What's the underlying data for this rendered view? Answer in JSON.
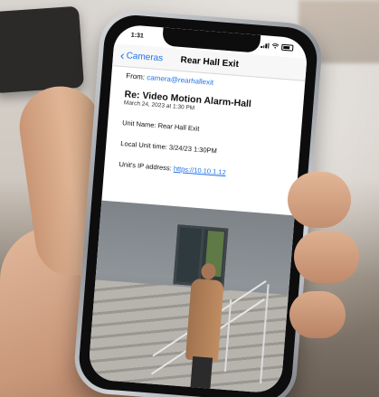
{
  "status_bar": {
    "time": "1:31"
  },
  "nav": {
    "back_label": "Cameras",
    "title": "Rear Hall Exit"
  },
  "email": {
    "from_label": "From:",
    "from_address": "camera@rearhallexit",
    "subject": "Re: Video Motion Alarm-Hall",
    "date": "March 24, 2023 at 1:30 PM",
    "unit_name": "Unit Name: Rear Hall Exit",
    "local_time": "Local Unit time: 3/24/23 1:30PM",
    "ip_label": "Unit's IP address:",
    "ip_link": "https://10.10.1.12"
  },
  "colors": {
    "link": "#1e73e8"
  }
}
